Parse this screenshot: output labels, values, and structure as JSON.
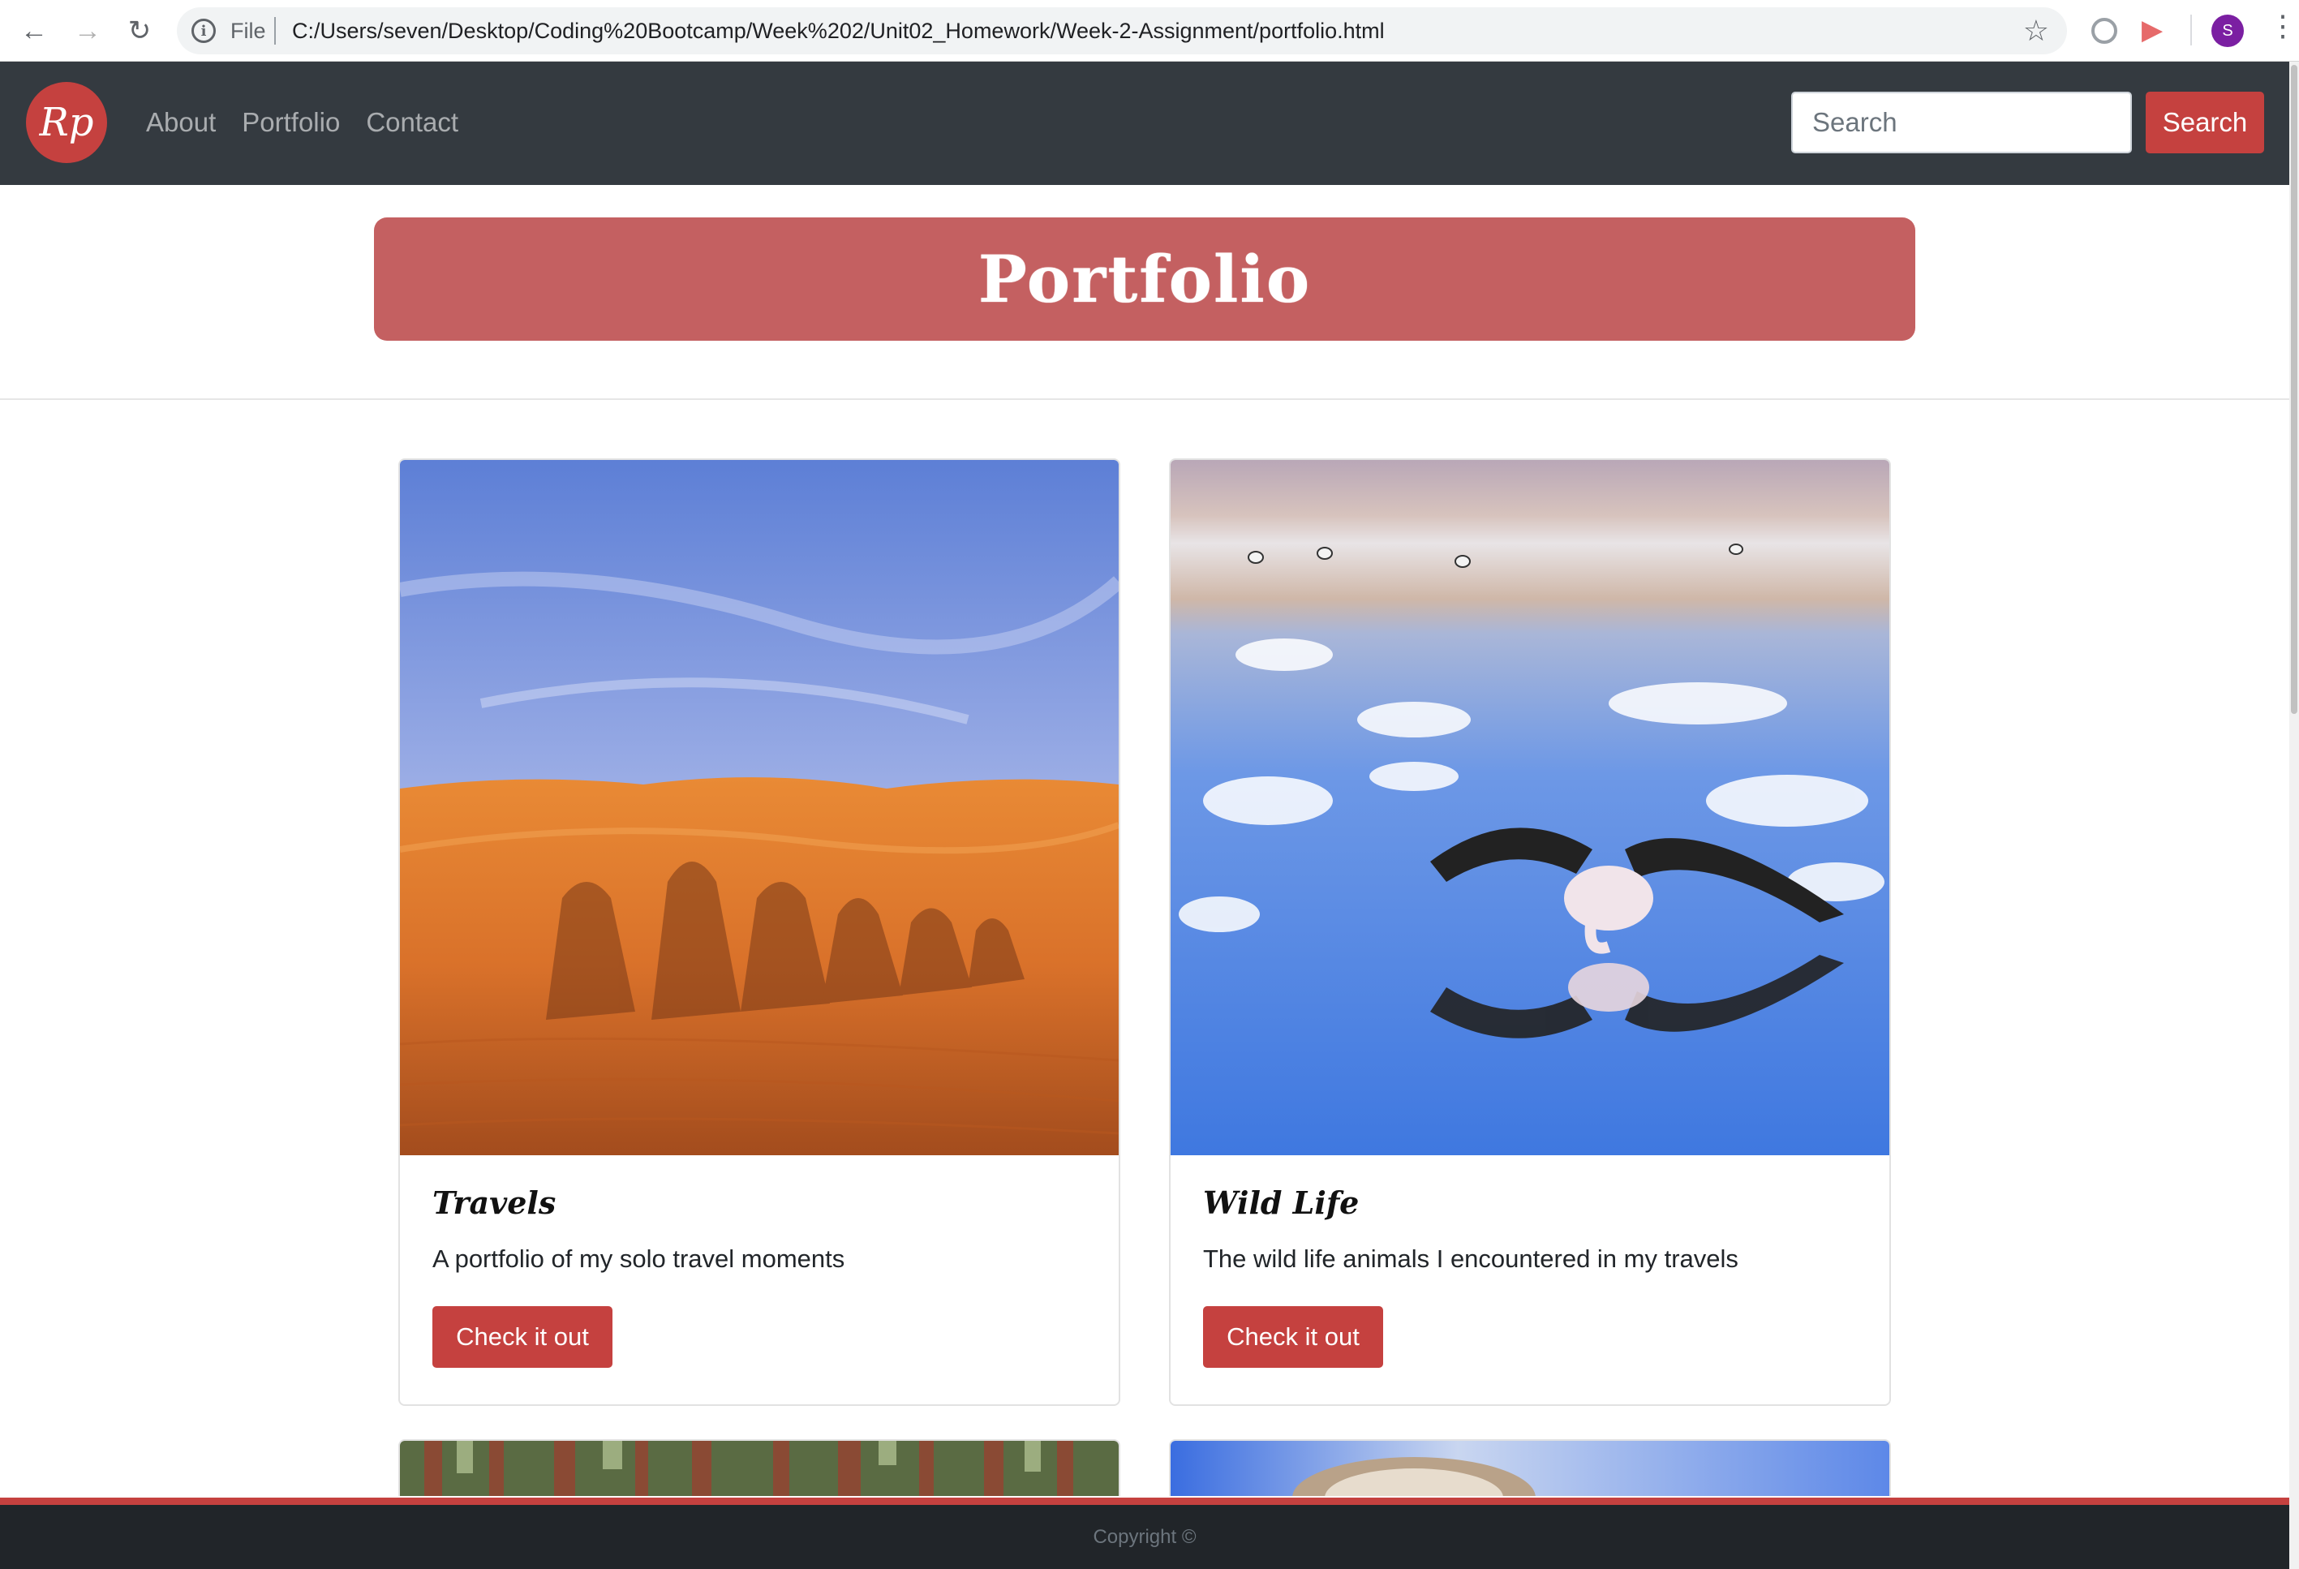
{
  "browser": {
    "file_label": "File",
    "url": "C:/Users/seven/Desktop/Coding%20Bootcamp/Week%202/Unit02_Homework/Week-2-Assignment/portfolio.html",
    "profile_initial": "S",
    "icons": {
      "back": "←",
      "forward": "→",
      "reload": "↻",
      "info": "i",
      "star": "☆",
      "menu": "⋮"
    }
  },
  "navbar": {
    "brand_logo": "Rp",
    "links": [
      "About",
      "Portfolio",
      "Contact"
    ],
    "search_placeholder": "Search",
    "search_button": "Search",
    "accent_color": "#c5413f"
  },
  "banner": {
    "title": "Portfolio",
    "color": "#c46061"
  },
  "cards": [
    {
      "title": "Travels",
      "text": "A portfolio of my solo travel moments",
      "button": "Check it out",
      "image": "desert-camel-shadows-image"
    },
    {
      "title": "Wild Life",
      "text": "The wild life animals I encountered in my travels",
      "button": "Check it out",
      "image": "flamingo-lake-image"
    }
  ],
  "footer": {
    "text": "Copyright ©"
  }
}
